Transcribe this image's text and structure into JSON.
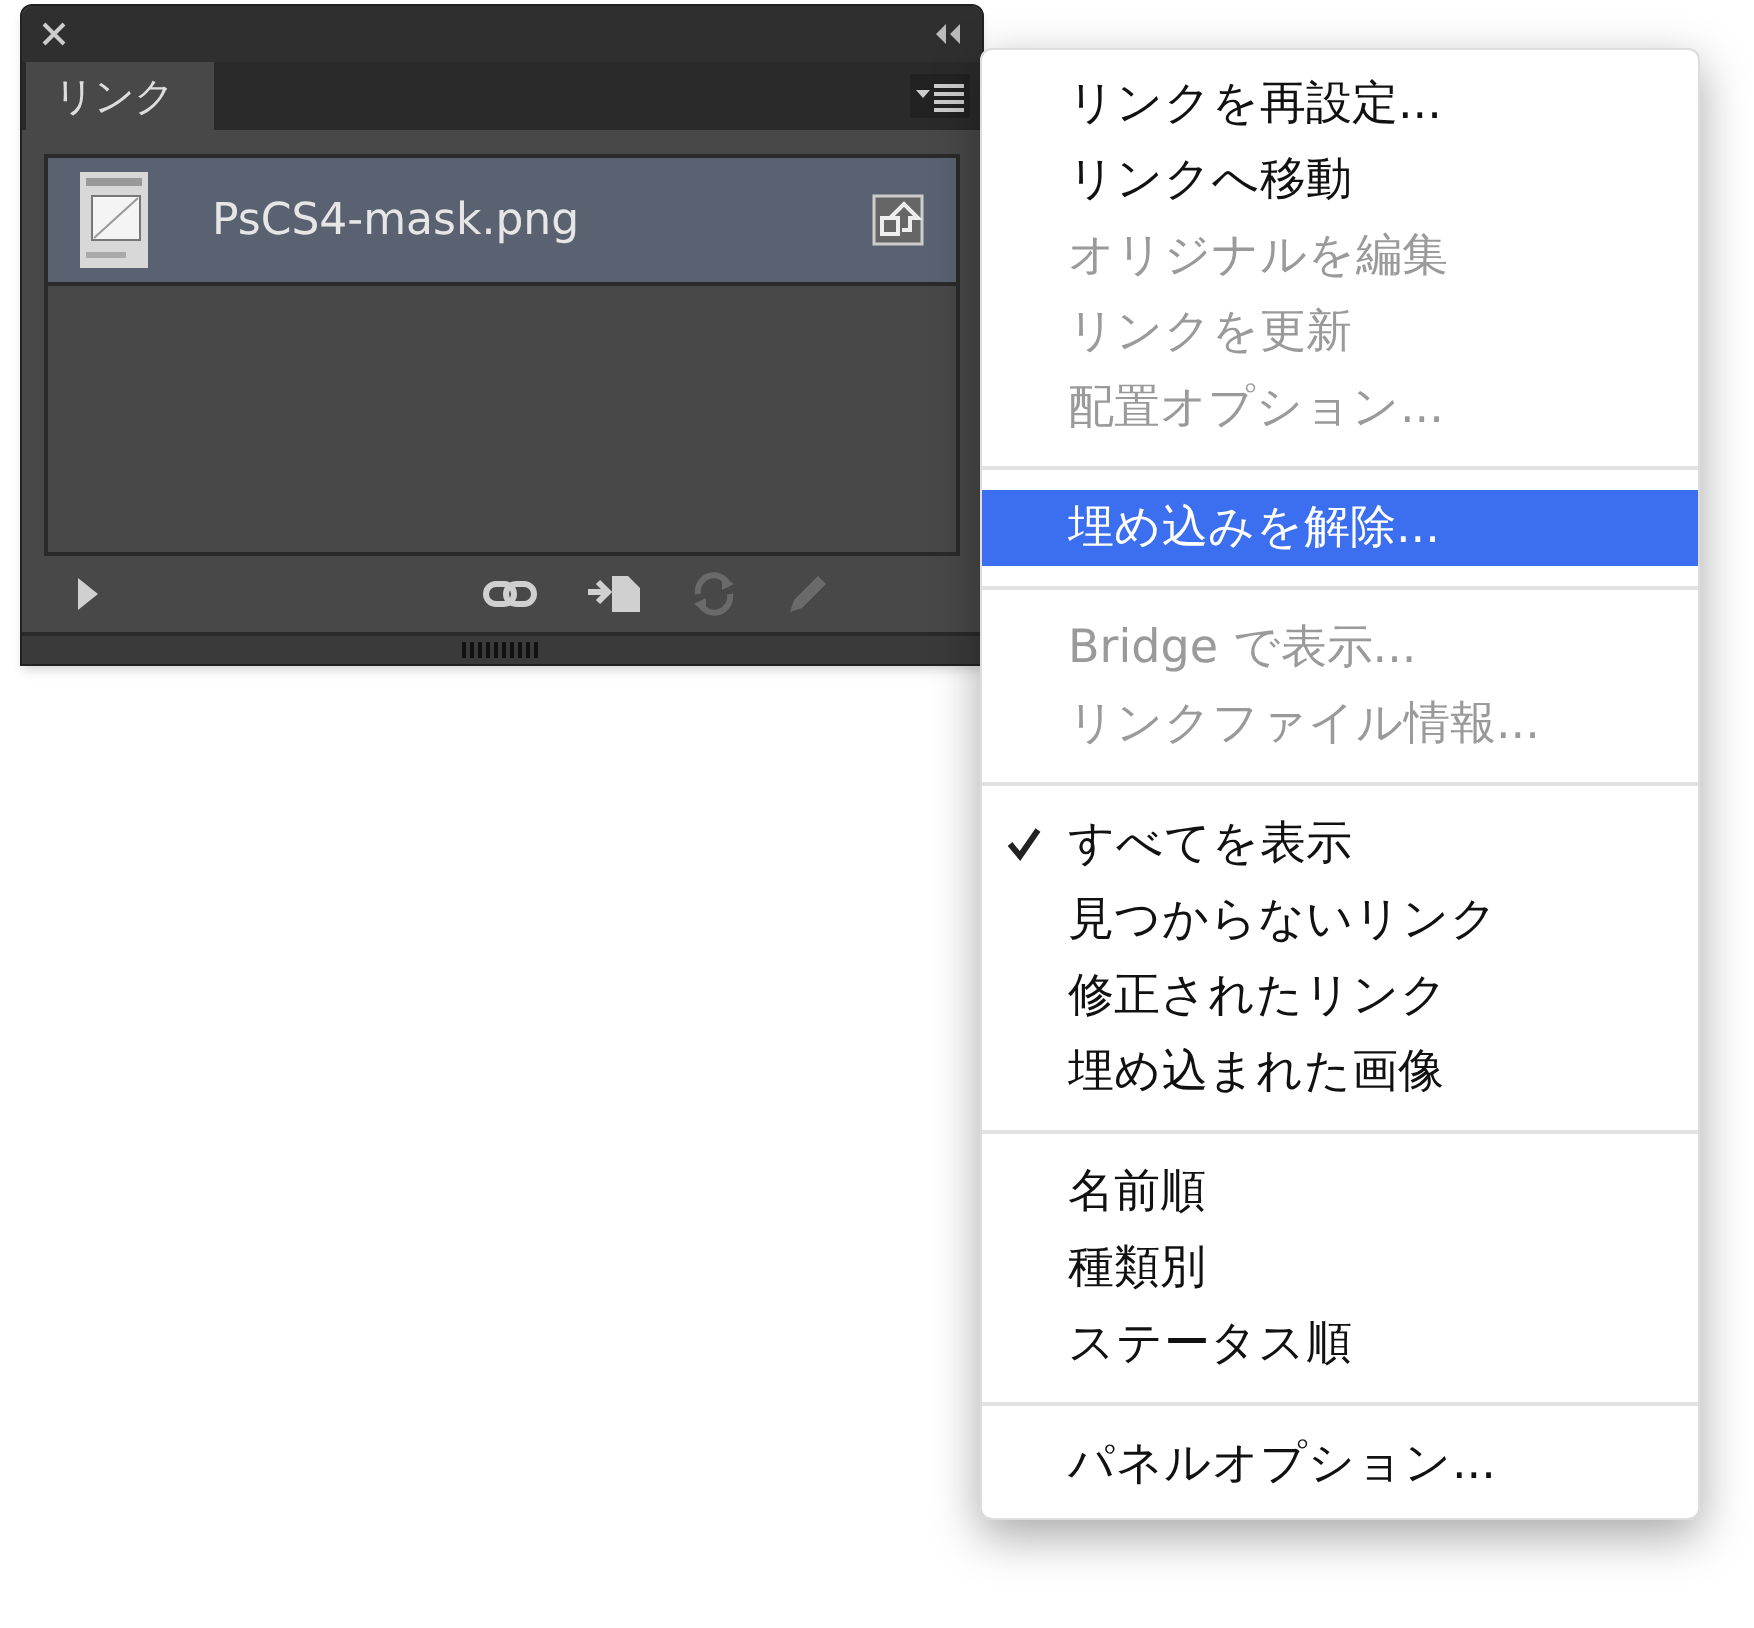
{
  "panel": {
    "tab": {
      "label": "リンク",
      "selected": true
    },
    "rows": [
      {
        "name": "PsCS4-mask.png",
        "selected": true
      }
    ],
    "footer_buttons": [
      {
        "kind": "expand",
        "disabled": false
      },
      {
        "kind": "relink",
        "disabled": false
      },
      {
        "kind": "goto",
        "disabled": false
      },
      {
        "kind": "update",
        "disabled": true
      },
      {
        "kind": "edit",
        "disabled": true
      }
    ]
  },
  "menu": {
    "sections": [
      [
        {
          "label": "リンクを再設定...",
          "disabled": false,
          "highlighted": false,
          "checked": false
        },
        {
          "label": "リンクへ移動",
          "disabled": false,
          "highlighted": false,
          "checked": false
        },
        {
          "label": "オリジナルを編集",
          "disabled": true,
          "highlighted": false,
          "checked": false
        },
        {
          "label": "リンクを更新",
          "disabled": true,
          "highlighted": false,
          "checked": false
        },
        {
          "label": "配置オプション...",
          "disabled": true,
          "highlighted": false,
          "checked": false
        }
      ],
      [
        {
          "label": "埋め込みを解除...",
          "disabled": false,
          "highlighted": true,
          "checked": false
        }
      ],
      [
        {
          "label": "Bridge で表示...",
          "disabled": true,
          "highlighted": false,
          "checked": false
        },
        {
          "label": "リンクファイル情報...",
          "disabled": true,
          "highlighted": false,
          "checked": false
        }
      ],
      [
        {
          "label": "すべてを表示",
          "disabled": false,
          "highlighted": false,
          "checked": true
        },
        {
          "label": "見つからないリンク",
          "disabled": false,
          "highlighted": false,
          "checked": false
        },
        {
          "label": "修正されたリンク",
          "disabled": false,
          "highlighted": false,
          "checked": false
        },
        {
          "label": "埋め込まれた画像",
          "disabled": false,
          "highlighted": false,
          "checked": false
        }
      ],
      [
        {
          "label": "名前順",
          "disabled": false,
          "highlighted": false,
          "checked": false
        },
        {
          "label": "種類別",
          "disabled": false,
          "highlighted": false,
          "checked": false
        },
        {
          "label": "ステータス順",
          "disabled": false,
          "highlighted": false,
          "checked": false
        }
      ],
      [
        {
          "label": "パネルオプション...",
          "disabled": false,
          "highlighted": false,
          "checked": false
        }
      ]
    ]
  }
}
